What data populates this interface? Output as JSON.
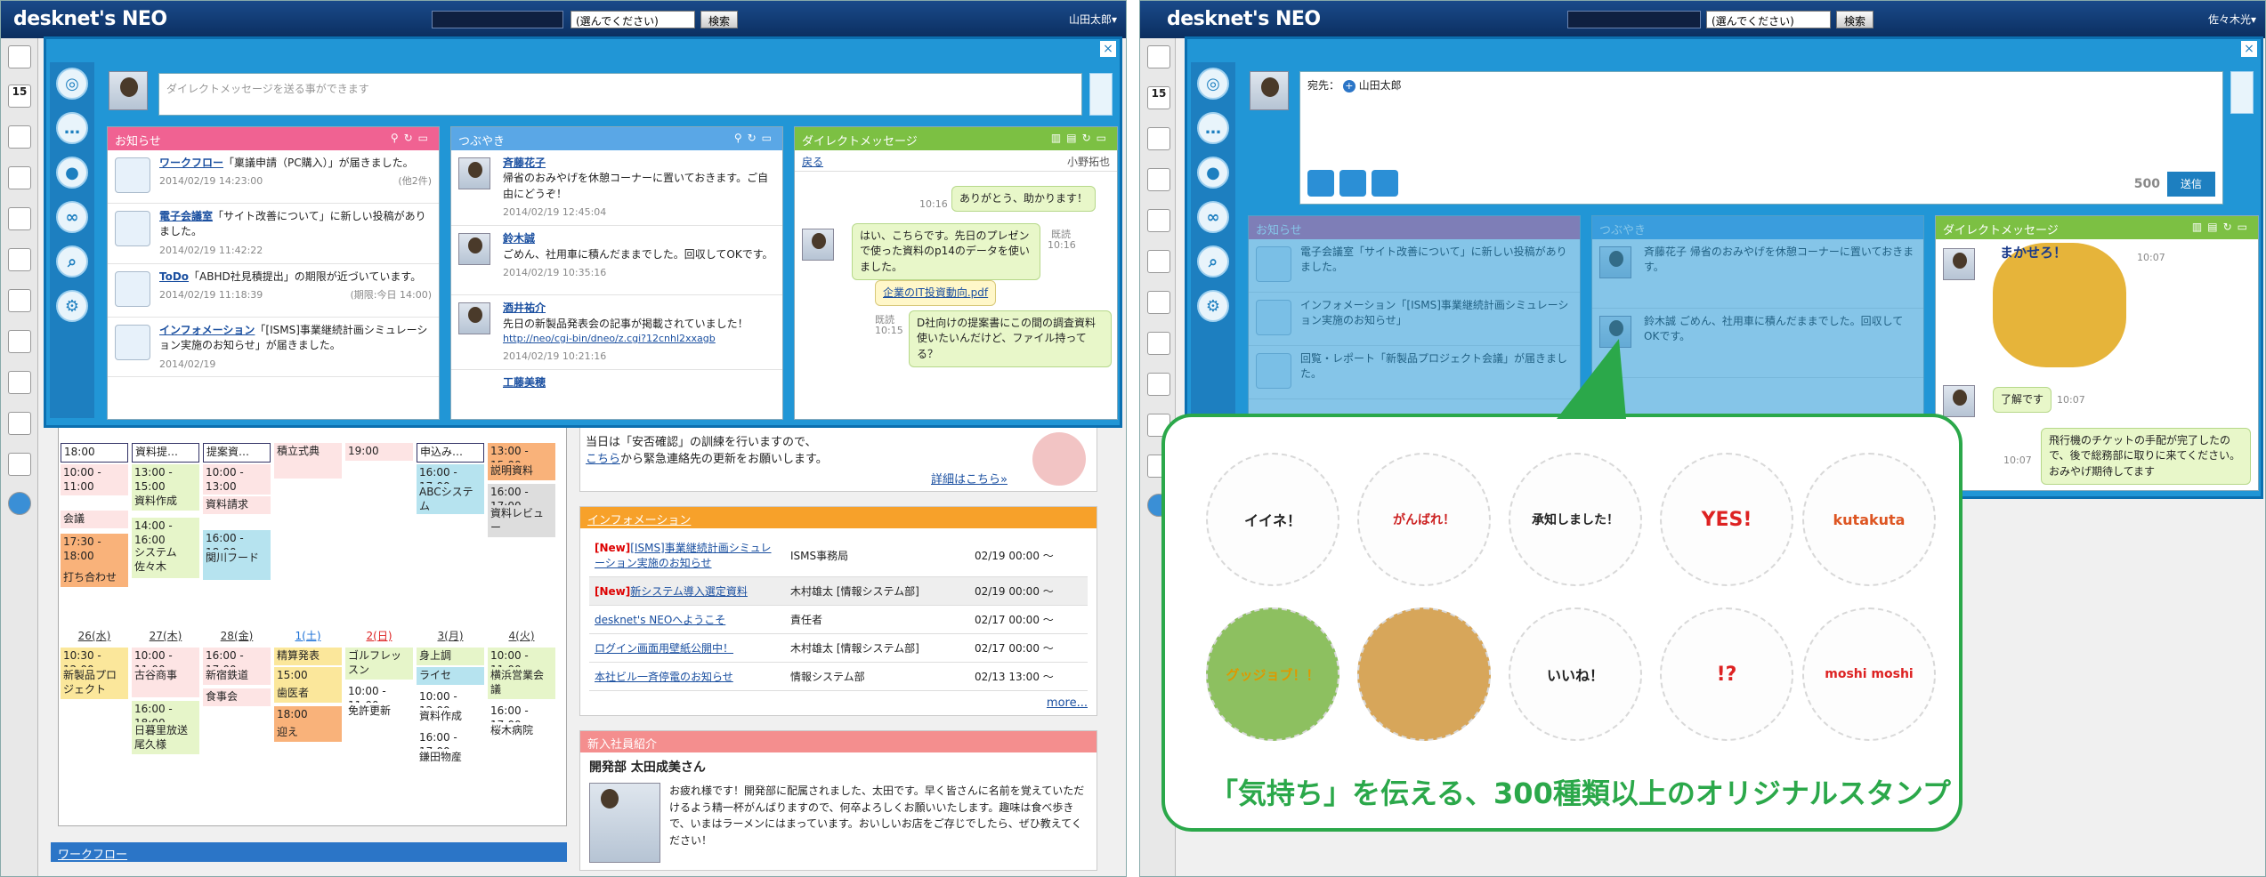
{
  "left": {
    "app": {
      "logo": "desknet's NEO",
      "select_label": "(選んでください)",
      "search_button": "検索",
      "user": "山田太郎▾"
    },
    "dm": {
      "placeholder": "ダイレクトメッセージを送る事ができます"
    },
    "notice": {
      "title": "お知らせ",
      "items": [
        {
          "link": "ワークフロー",
          "text": "「稟議申請（PC購入）」が届きました。",
          "date": "2014/02/19 14:23:00",
          "extra": "(他2件)"
        },
        {
          "link": "電子会議室",
          "text": "「サイト改善について」に新しい投稿がありました。",
          "date": "2014/02/19 11:42:22",
          "extra": ""
        },
        {
          "link": "ToDo",
          "text": "「ABHD社見積提出」の期限が近づいています。",
          "date": "2014/02/19 11:18:39",
          "extra": "(期限:今日 14:00)"
        },
        {
          "link": "インフォメーション",
          "text": "「[ISMS]事業継続計画シミュレーション実施のお知らせ」が届きました。",
          "date": "2014/02/19",
          "extra": ""
        }
      ]
    },
    "tweet": {
      "title": "つぶやき",
      "items": [
        {
          "name": "斉藤花子",
          "text": "帰省のおみやげを休憩コーナーに置いておきます。ご自由にどうぞ！",
          "date": "2014/02/19 12:45:04"
        },
        {
          "name": "鈴木誠",
          "text": "ごめん、社用車に積んだままでした。回収してOKです。",
          "date": "2014/02/19 10:35:16"
        },
        {
          "name": "酒井祐介",
          "text": "先日の新製品発表会の記事が掲載されていました！",
          "url": "http://neo/cgi-bin/dneo/z.cgi?12cnhl2xxagb",
          "date": "2014/02/19 10:21:16"
        },
        {
          "name": "工藤美穂",
          "text": "",
          "date": ""
        }
      ]
    },
    "direct": {
      "title": "ダイレクトメッセージ",
      "back": "戻る",
      "partner": "小野拓也",
      "messages": [
        {
          "text": "ありがとう、助かります！",
          "time": "10:16",
          "read": ""
        },
        {
          "text": "はい、こちらです。先日のプレゼンで使った資料のp14のデータを使いました。",
          "time": "10:16",
          "read": "既読"
        },
        {
          "text": "企業のIT投資動向.pdf",
          "time": "",
          "read": ""
        },
        {
          "text": "D社向けの提案書にこの間の調査資料使いたいんだけど、ファイル持ってる？",
          "time": "10:15",
          "read": "既読"
        }
      ]
    },
    "calendar": {
      "week1": [
        {
          "day": "",
          "events": [
            "18:00",
            "10:00 - 11:00",
            "会議",
            "17:30 - 18:00",
            "打ち合わせ"
          ]
        },
        {
          "day": "",
          "events": [
            "資料提…",
            "13:00 - 15:00",
            "資料作成",
            "14:00 - 16:00",
            "システム佐々木"
          ]
        },
        {
          "day": "",
          "events": [
            "提案資…",
            "10:00 - 13:00",
            "資料請求",
            "16:00 - 18:00",
            "関川フード"
          ]
        },
        {
          "day": "",
          "events": [
            "積立式典",
            "",
            "",
            "",
            ""
          ]
        },
        {
          "day": "",
          "events": [
            "19:00",
            "",
            "",
            "",
            ""
          ]
        },
        {
          "day": "",
          "events": [
            "申込み…",
            "16:00 - 17:00",
            "ABCシステム",
            "",
            ""
          ]
        },
        {
          "day": "",
          "events": [
            "13:00 - 15:00",
            "説明資料",
            "16:00 - 17:00",
            "資料レビュー",
            ""
          ]
        }
      ],
      "days2": [
        "26(水)",
        "27(木)",
        "28(金)",
        "1(土)",
        "2(日)",
        "3(月)",
        "4(火)"
      ],
      "week2": [
        [
          "10:30 - 12:00",
          "新製品プロジェクト"
        ],
        [
          "10:00 - 11:00",
          "古谷商事",
          "16:00 - 18:00",
          "日暮里放送尾久様"
        ],
        [
          "16:00 - 17:00",
          "新宿鉄道",
          "食事会"
        ],
        [
          "精算発表",
          "15:00",
          "歯医者",
          "18:00",
          "迎え"
        ],
        [
          "ゴルフレッスン",
          "10:00 - 11:00",
          "免許更新"
        ],
        [
          "身上調",
          "ライセ",
          "10:00 - 12:00",
          "資料作成",
          "16:00 - 17:00",
          "鎌田物産"
        ],
        [
          "10:00 - 11:00",
          "横浜営業会議",
          "16:00 - 17:00",
          "桜木病院"
        ]
      ],
      "workflow": "ワークフロー"
    },
    "notice_text": {
      "line1": "当日は「安否確認」の訓練を行いますので、",
      "line2link": "こちら",
      "line2": "から緊急連絡先の更新をお願いします。",
      "more": "詳細はこちら»"
    },
    "information": {
      "title": "インフォメーション",
      "rows": [
        {
          "new": "[New]",
          "title": "[ISMS]事業継続計画シミュレーション実施のお知らせ",
          "from": "ISMS事務局",
          "date": "02/19 00:00 ～"
        },
        {
          "new": "[New]",
          "title": "新システム導入選定資料",
          "from": "木村雄太 [情報システム部]",
          "date": "02/19 00:00 ～"
        },
        {
          "new": "",
          "title": "desknet's NEOへようこそ",
          "from": "責任者",
          "date": "02/17 00:00 ～"
        },
        {
          "new": "",
          "title": "ログイン画面用壁紙公開中！",
          "from": "木村雄太 [情報システム部]",
          "date": "02/17 00:00 ～"
        },
        {
          "new": "",
          "title": "本社ビル一斉停電のお知らせ",
          "from": "情報システム部",
          "date": "02/13 13:00 ～"
        }
      ],
      "more": "more..."
    },
    "newcomer": {
      "title": "新入社員紹介",
      "name": "開発部 太田成美さん",
      "text": "お疲れ様です！開発部に配属されました、太田です。早く皆さんに名前を覚えていただけるよう精一杯がんばりますので、何卒よろしくお願いいたします。趣味は食べ歩きで、いまはラーメンにはまっています。おいしいお店をご存じでしたら、ぜひ教えてください！"
    }
  },
  "right": {
    "app": {
      "logo": "desknet's NEO",
      "select_label": "(選んでください)",
      "search_button": "検索",
      "user": "佐々木光▾"
    },
    "compose": {
      "to_label": "宛先：",
      "to_user": "山田太郎",
      "count": "500",
      "send": "送信"
    },
    "notice_dim": {
      "title": "お知らせ",
      "items": [
        "電子会議室「サイト改善について」に新しい投稿がありました。",
        "インフォメーション「[ISMS]事業継続計画シミュレーション実施のお知らせ」",
        "回覧・レポート「新製品プロジェクト会議」が届きました。"
      ]
    },
    "tweet_dim": {
      "title": "つぶやき",
      "items": [
        "斉藤花子 帰省のおみやげを休憩コーナーに置いておきます。",
        "鈴木誠 ごめん、社用車に積んだままでした。回収してOKです。"
      ]
    },
    "direct": {
      "title": "ダイレクトメッセージ",
      "stamp_text": "まかせろ！",
      "time1": "10:07",
      "msg2": "了解です",
      "time2": "10:07",
      "msg3": "飛行機のチケットの手配が完了したので、後で総務部に取りに来てください。おみやげ期待してます",
      "time3": "10:07"
    },
    "stamps": [
      "イイネ！",
      "がんばれ！",
      "承知しました！",
      "YES!",
      "kutakuta",
      "グッジョブ！！",
      "",
      "いいね！",
      "!?",
      "moshi moshi"
    ],
    "caption": "「気持ち」を伝える、300種類以上のオリジナルスタンプ"
  },
  "colors": {
    "accent_blue": "#2196d6",
    "notice_pink": "#f06292",
    "tweet_blue": "#5aa7e6",
    "dm_green": "#7cc043",
    "caption_green": "#2ba84a"
  }
}
